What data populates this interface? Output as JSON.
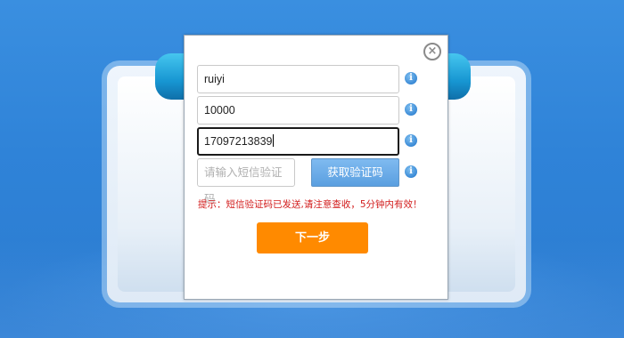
{
  "dialog": {
    "close_icon": "close-circle-icon",
    "username": {
      "value": "ruiyi"
    },
    "code_field": {
      "value": "10000"
    },
    "phone": {
      "value": "17097213839"
    },
    "sms_code": {
      "placeholder": "请输入短信验证码"
    },
    "get_code_label": "获取验证码",
    "info_icon_glyph": "i",
    "hint_text": "提示：短信验证码已发送,请注意查收，5分钟内有效！",
    "next_label": "下一步"
  },
  "colors": {
    "background": "#2f83d8",
    "accent_orange": "#ff8a00",
    "code_button": "#6aaae8",
    "hint_red": "#d21c1c",
    "info_icon": "#3a8ad6"
  }
}
